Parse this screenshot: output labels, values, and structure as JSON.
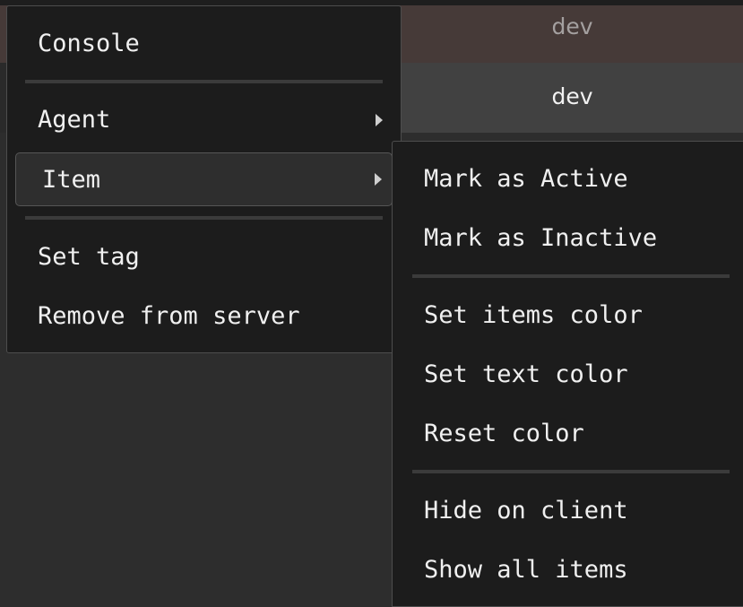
{
  "background_rows": [
    {
      "label": "dev"
    },
    {
      "label": "dev"
    }
  ],
  "main_menu": {
    "items": [
      {
        "label": "Console"
      },
      {
        "label": "Agent"
      },
      {
        "label": "Item"
      },
      {
        "label": "Set tag"
      },
      {
        "label": "Remove from server"
      }
    ]
  },
  "item_submenu": {
    "items": [
      {
        "label": "Mark as Active"
      },
      {
        "label": "Mark as Inactive"
      },
      {
        "label": "Set items color"
      },
      {
        "label": "Set text color"
      },
      {
        "label": "Reset color"
      },
      {
        "label": "Hide on client"
      },
      {
        "label": "Show all items"
      }
    ]
  },
  "icons": {
    "agent_arrow": "chevron-right-icon",
    "item_arrow": "chevron-right-icon"
  },
  "colors": {
    "menu_background": "#1c1c1c",
    "menu_border": "#4d4d4d",
    "highlight_background": "#2e2e2e",
    "text": "#f0f0f0",
    "row_1_background": "#463a38",
    "row_2_background": "#414141"
  }
}
